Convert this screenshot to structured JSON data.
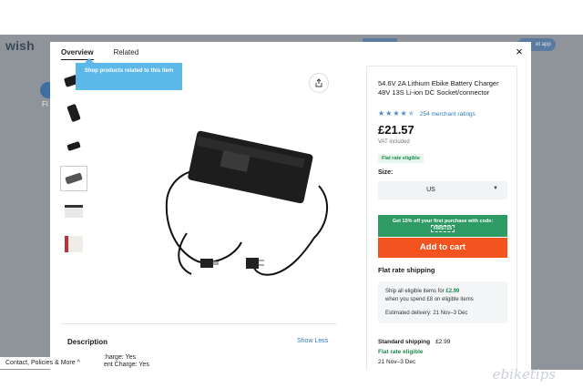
{
  "background": {
    "logo": "wish",
    "category_label": "Fi",
    "app_button": "et app"
  },
  "modal": {
    "tabs": [
      {
        "label": "Overview",
        "active": true
      },
      {
        "label": "Related",
        "active": false
      }
    ],
    "close_icon": "×",
    "tooltip": "Shop products related to this item",
    "thumbnails_count": 6,
    "description": {
      "title": "Description",
      "toggle": "Show Less",
      "lines": [
        ":harge: Yes",
        "ent Charge: Yes"
      ]
    }
  },
  "product": {
    "title": "54.6V 2A Lithium Ebike Battery Charger 48V 13S Li-ion DC Socket/connector",
    "rating": 4.5,
    "ratings_text": "254 merchant ratings",
    "price": "£21.57",
    "vat": "VAT included",
    "flat_rate_badge": "Flat rate eligible",
    "size_label": "Size:",
    "size_value": "US",
    "promo_text": "Get 15% off your first purchase with code:",
    "promo_code": "FIRST15",
    "add_to_cart": "Add to cart",
    "shipping": {
      "heading": "Flat rate shipping",
      "ship_all_prefix": "Ship all eligible items for",
      "ship_all_price": "£2.99",
      "ship_all_suffix": "when you spend £8 on eligible items",
      "estimated": "Estimated delivery: 21 Nov–3 Dec",
      "standard_label": "Standard shipping",
      "standard_price": "£2.99",
      "standard_eligible": "Flat rate eligible",
      "standard_dates": "21 Nov–3 Dec"
    }
  },
  "footer": {
    "link": "Contact, Policies & More",
    "caret": "^"
  },
  "watermark": "ebiketips",
  "colors": {
    "cart": "#f3541f",
    "promo": "#2d9b63",
    "link": "#2b7bbf",
    "tooltip": "#5cb8e8"
  }
}
